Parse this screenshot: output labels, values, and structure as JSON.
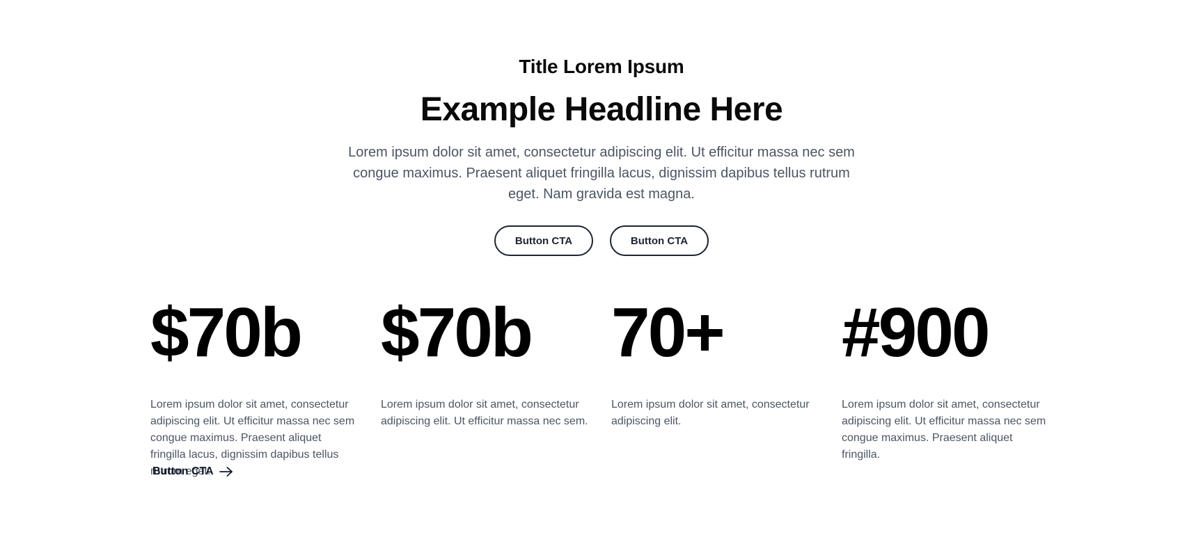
{
  "hero": {
    "eyebrow": "Title Lorem Ipsum",
    "headline": "Example Headline Here",
    "intro": "Lorem ipsum dolor sit amet, consectetur adipiscing elit. Ut efficitur massa nec sem congue maximus. Praesent aliquet fringilla lacus, dignissim dapibus tellus rutrum eget. Nam gravida est magna.",
    "buttons": [
      {
        "label": "Button CTA"
      },
      {
        "label": "Button CTA"
      }
    ]
  },
  "stats": [
    {
      "value": "$70b",
      "description": "Lorem ipsum dolor sit amet, consectetur adipiscing elit. Ut efficitur massa nec sem congue maximus. Praesent aliquet fringilla lacus, dignissim dapibus tellus rutrum eget."
    },
    {
      "value": "$70b",
      "description": "Lorem ipsum dolor sit amet, consectetur adipiscing elit. Ut efficitur massa nec sem."
    },
    {
      "value": "70+",
      "description": "Lorem ipsum dolor sit amet, consectetur adipiscing elit."
    },
    {
      "value": "#900",
      "description": "Lorem ipsum dolor sit amet, consectetur adipiscing elit. Ut efficitur massa nec sem congue maximus. Praesent aliquet fringilla."
    }
  ],
  "link_cta": {
    "label": "Button CTA",
    "icon": "arrow-right-icon"
  },
  "colors": {
    "text_primary": "#0a0a0a",
    "text_secondary": "#4b5563",
    "button_border": "#1f2433",
    "background": "#ffffff"
  }
}
